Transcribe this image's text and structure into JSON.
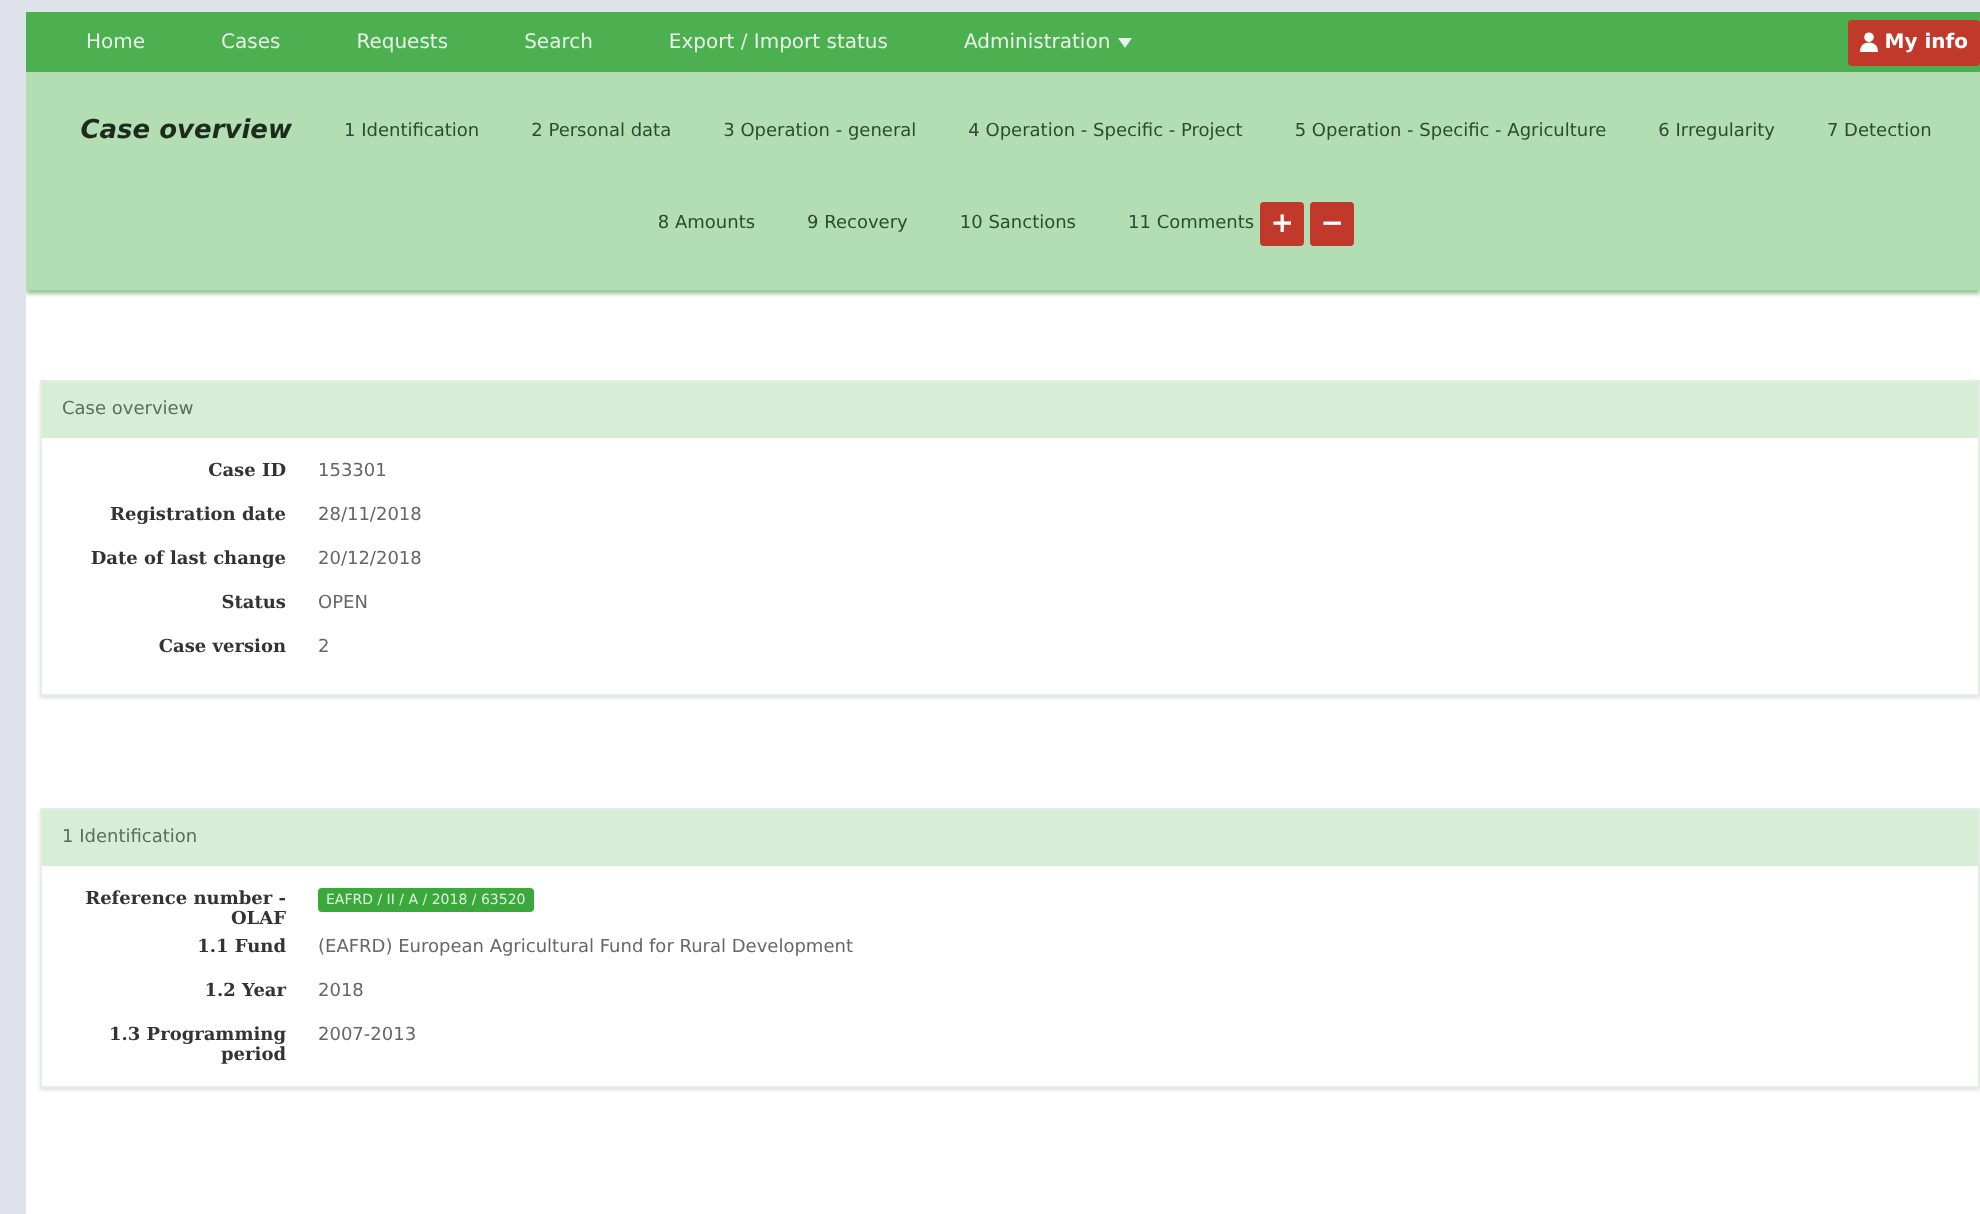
{
  "navbar": {
    "items": [
      {
        "label": "Home",
        "kind": "link"
      },
      {
        "label": "Cases",
        "kind": "link"
      },
      {
        "label": "Requests",
        "kind": "link"
      },
      {
        "label": "Search",
        "kind": "link"
      },
      {
        "label": "Export / Import status",
        "kind": "link"
      },
      {
        "label": "Administration",
        "kind": "dropdown"
      }
    ],
    "user_button": "My info"
  },
  "section_tabs": {
    "tabs": [
      {
        "label": "Case overview",
        "selected": true
      },
      {
        "label": "1 Identification",
        "selected": false
      },
      {
        "label": "2 Personal data",
        "selected": false
      },
      {
        "label": "3 Operation - general",
        "selected": false
      },
      {
        "label": "4 Operation - Specific - Project",
        "selected": false
      },
      {
        "label": "5 Operation - Specific - Agriculture",
        "selected": false
      },
      {
        "label": "6 Irregularity",
        "selected": false
      },
      {
        "label": "7 Detection",
        "selected": false
      },
      {
        "label": "8 Amounts",
        "selected": false
      },
      {
        "label": "9 Recovery",
        "selected": false
      },
      {
        "label": "10 Sanctions",
        "selected": false
      },
      {
        "label": "11 Comments",
        "selected": false
      }
    ],
    "buttons": [
      "+",
      "−"
    ]
  },
  "panels": [
    {
      "title": "Case overview",
      "fields": [
        {
          "label": "Case ID",
          "value": "153301",
          "kind": "text"
        },
        {
          "label": "Registration date",
          "value": "28/11/2018",
          "kind": "text"
        },
        {
          "label": "Date of last change",
          "value": "20/12/2018",
          "kind": "text"
        },
        {
          "label": "Status",
          "value": "OPEN",
          "kind": "text"
        },
        {
          "label": "Case version",
          "value": "2",
          "kind": "text"
        }
      ]
    },
    {
      "title": "1 Identification",
      "fields": [
        {
          "label": "Reference number - OLAF",
          "value": "EAFRD / II / A / 2018 / 63520",
          "kind": "badge"
        },
        {
          "label": "1.1 Fund",
          "value": "(EAFRD) European Agricultural Fund for Rural Development",
          "kind": "text"
        },
        {
          "label": "1.2 Year",
          "value": "2018",
          "kind": "text"
        },
        {
          "label": "1.3 Programming period",
          "value": "2007-2013",
          "kind": "text"
        }
      ]
    }
  ]
}
